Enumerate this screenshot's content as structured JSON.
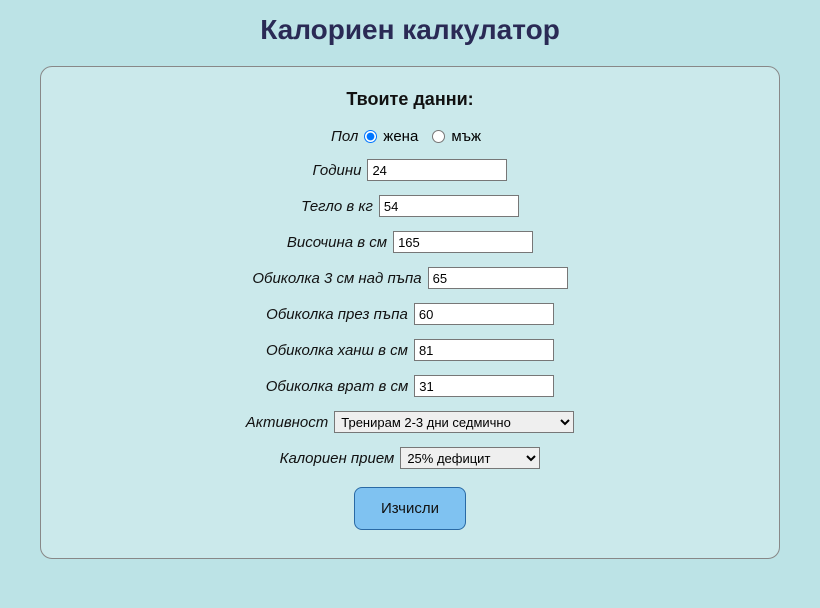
{
  "title": "Калориен калкулатор",
  "form": {
    "heading": "Твоите данни:",
    "gender": {
      "label": "Пол",
      "female": "жена",
      "male": "мъж",
      "selected": "female"
    },
    "age": {
      "label": "Години",
      "value": "24"
    },
    "weight": {
      "label": "Тегло в кг",
      "value": "54"
    },
    "height": {
      "label": "Височина в см",
      "value": "165"
    },
    "circ_above_navel": {
      "label": "Обиколка 3 см над пъпа",
      "value": "65"
    },
    "circ_at_navel": {
      "label": "Обиколка през пъпа",
      "value": "60"
    },
    "circ_hip": {
      "label": "Обиколка ханш в см",
      "value": "81"
    },
    "circ_neck": {
      "label": "Обиколка врат в см",
      "value": "31"
    },
    "activity": {
      "label": "Активност",
      "selected": "Тренирам 2-3 дни седмично"
    },
    "intake": {
      "label": "Калориен прием",
      "selected": "25% дефицит"
    },
    "submit": "Изчисли"
  }
}
